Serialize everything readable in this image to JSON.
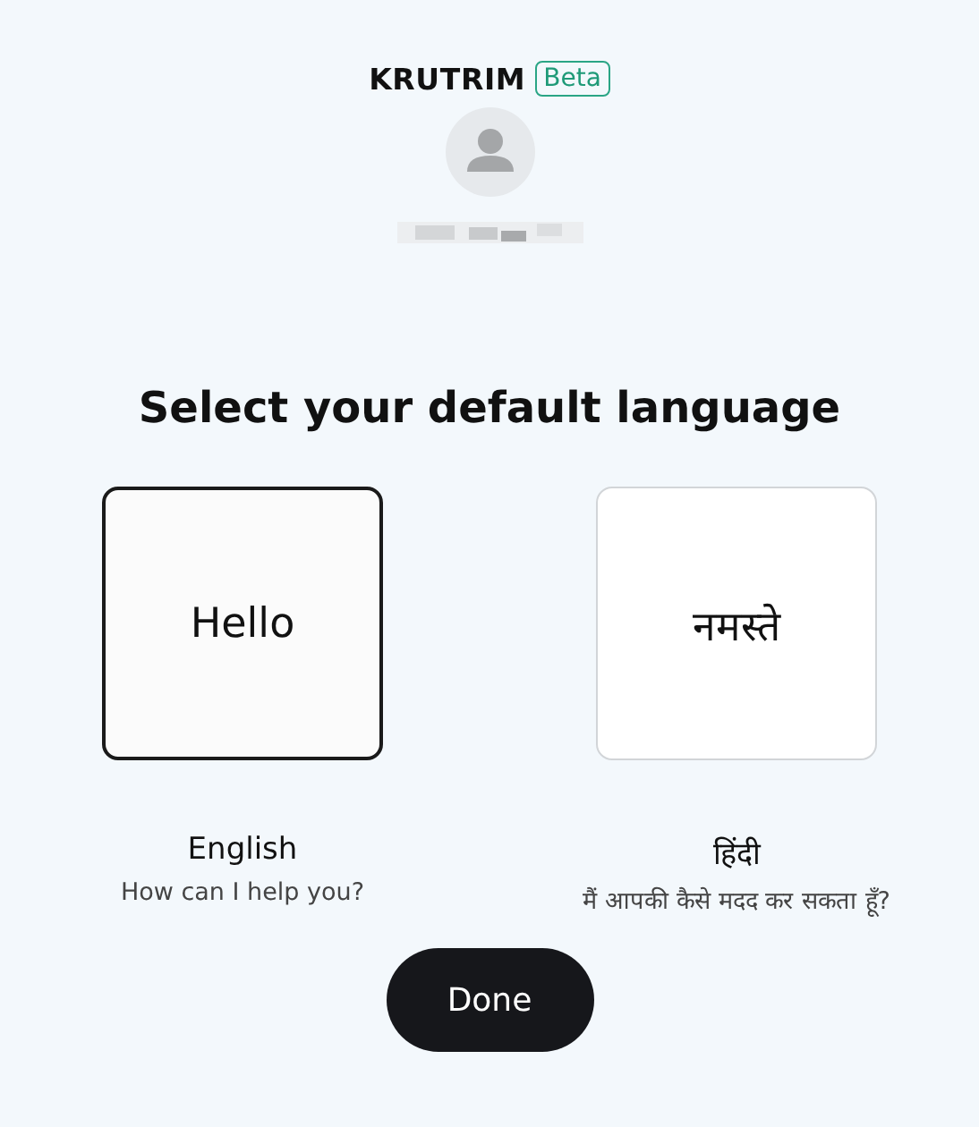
{
  "logo": {
    "name": "KRUTRIM",
    "badge": "Beta"
  },
  "heading": "Select your default language",
  "languages": [
    {
      "greeting": "Hello",
      "name": "English",
      "subtitle": "How can I help you?",
      "selected": true
    },
    {
      "greeting": "नमस्ते",
      "name": "हिंदी",
      "subtitle": "मैं आपकी कैसे मदद कर सकता हूँ?",
      "selected": false
    }
  ],
  "button": "Done"
}
